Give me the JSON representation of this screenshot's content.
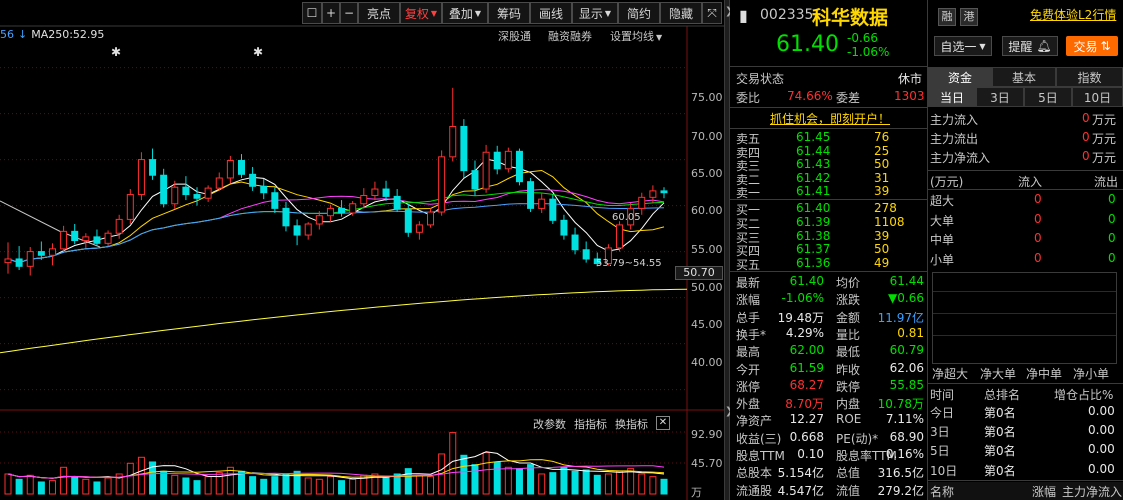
{
  "toolbar": {
    "buttons": [
      "亮点",
      "复权",
      "叠加",
      "筹码",
      "画线",
      "显示",
      "简约",
      "隐藏"
    ],
    "icons": [
      "lock-icon",
      "plus-icon",
      "minus-icon"
    ]
  },
  "chart": {
    "ma_legend": {
      "prefix": "56",
      "ma250_label": "MA250:52.95"
    },
    "sub_links": [
      "深股通",
      "融资融券",
      "设置均线"
    ],
    "right_ticks": [
      "75.00",
      "70.00",
      "65.00",
      "60.00",
      "55.00",
      "50.00",
      "45.00",
      "40.00"
    ],
    "current_price_box": "50.70",
    "annotations": [
      "60.05",
      "53.79",
      "54.55"
    ],
    "bottom_links": [
      "改参数",
      "指指标",
      "换指标"
    ],
    "vol_ticks": [
      "92.90",
      "45.70"
    ],
    "vol_unit": "万"
  },
  "chart_data": [
    {
      "type": "candlestick",
      "title": "",
      "ylim": [
        38,
        78
      ],
      "candles": [
        {
          "o": 53.8,
          "h": 56.0,
          "l": 52.6,
          "c": 54.2
        },
        {
          "o": 54.2,
          "h": 55.6,
          "l": 53.0,
          "c": 53.4
        },
        {
          "o": 53.4,
          "h": 55.5,
          "l": 52.4,
          "c": 55.0
        },
        {
          "o": 55.0,
          "h": 56.1,
          "l": 54.1,
          "c": 54.6
        },
        {
          "o": 54.6,
          "h": 55.9,
          "l": 53.5,
          "c": 55.3
        },
        {
          "o": 55.3,
          "h": 57.8,
          "l": 55.0,
          "c": 57.2
        },
        {
          "o": 57.2,
          "h": 58.0,
          "l": 55.8,
          "c": 56.2
        },
        {
          "o": 56.2,
          "h": 57.0,
          "l": 55.4,
          "c": 56.6
        },
        {
          "o": 56.6,
          "h": 57.4,
          "l": 55.6,
          "c": 55.9
        },
        {
          "o": 55.9,
          "h": 57.3,
          "l": 55.6,
          "c": 57.0
        },
        {
          "o": 57.0,
          "h": 59.0,
          "l": 56.4,
          "c": 58.5
        },
        {
          "o": 58.5,
          "h": 61.8,
          "l": 58.0,
          "c": 61.2
        },
        {
          "o": 61.2,
          "h": 65.8,
          "l": 60.6,
          "c": 65.0
        },
        {
          "o": 65.0,
          "h": 66.2,
          "l": 62.8,
          "c": 63.3
        },
        {
          "o": 63.3,
          "h": 64.0,
          "l": 59.8,
          "c": 60.2
        },
        {
          "o": 60.2,
          "h": 62.7,
          "l": 59.6,
          "c": 62.0
        },
        {
          "o": 62.0,
          "h": 63.2,
          "l": 60.6,
          "c": 61.2
        },
        {
          "o": 61.2,
          "h": 62.0,
          "l": 60.0,
          "c": 60.8
        },
        {
          "o": 60.8,
          "h": 62.2,
          "l": 60.4,
          "c": 61.9
        },
        {
          "o": 61.9,
          "h": 63.6,
          "l": 61.6,
          "c": 63.0
        },
        {
          "o": 63.0,
          "h": 65.4,
          "l": 62.4,
          "c": 64.9
        },
        {
          "o": 64.9,
          "h": 65.6,
          "l": 63.0,
          "c": 63.4
        },
        {
          "o": 63.4,
          "h": 64.2,
          "l": 61.6,
          "c": 62.1
        },
        {
          "o": 62.1,
          "h": 62.9,
          "l": 60.7,
          "c": 61.4
        },
        {
          "o": 61.4,
          "h": 62.0,
          "l": 59.2,
          "c": 59.7
        },
        {
          "o": 59.7,
          "h": 60.4,
          "l": 57.2,
          "c": 57.8
        },
        {
          "o": 57.8,
          "h": 58.5,
          "l": 55.7,
          "c": 56.8
        },
        {
          "o": 56.8,
          "h": 58.2,
          "l": 56.3,
          "c": 58.0
        },
        {
          "o": 58.0,
          "h": 59.4,
          "l": 57.4,
          "c": 58.9
        },
        {
          "o": 58.9,
          "h": 60.1,
          "l": 58.2,
          "c": 59.7
        },
        {
          "o": 59.7,
          "h": 60.6,
          "l": 58.8,
          "c": 59.2
        },
        {
          "o": 59.2,
          "h": 60.5,
          "l": 58.9,
          "c": 60.2
        },
        {
          "o": 60.2,
          "h": 61.9,
          "l": 59.7,
          "c": 61.1
        },
        {
          "o": 61.1,
          "h": 62.6,
          "l": 60.6,
          "c": 61.8
        },
        {
          "o": 61.8,
          "h": 62.7,
          "l": 60.5,
          "c": 61.0
        },
        {
          "o": 61.0,
          "h": 61.8,
          "l": 59.3,
          "c": 59.6
        },
        {
          "o": 59.6,
          "h": 60.2,
          "l": 56.6,
          "c": 57.1
        },
        {
          "o": 57.1,
          "h": 58.3,
          "l": 56.3,
          "c": 57.9
        },
        {
          "o": 57.9,
          "h": 59.7,
          "l": 57.6,
          "c": 59.3
        },
        {
          "o": 59.3,
          "h": 66.0,
          "l": 58.9,
          "c": 65.3
        },
        {
          "o": 65.3,
          "h": 72.8,
          "l": 64.8,
          "c": 68.6
        },
        {
          "o": 68.6,
          "h": 69.4,
          "l": 63.0,
          "c": 63.8
        },
        {
          "o": 63.8,
          "h": 64.9,
          "l": 61.1,
          "c": 61.8
        },
        {
          "o": 61.8,
          "h": 66.6,
          "l": 61.4,
          "c": 65.8
        },
        {
          "o": 65.8,
          "h": 66.5,
          "l": 63.4,
          "c": 64.0
        },
        {
          "o": 64.0,
          "h": 66.3,
          "l": 63.6,
          "c": 65.9
        },
        {
          "o": 65.9,
          "h": 66.2,
          "l": 62.2,
          "c": 62.6
        },
        {
          "o": 62.6,
          "h": 63.0,
          "l": 59.3,
          "c": 59.7
        },
        {
          "o": 59.7,
          "h": 61.4,
          "l": 59.2,
          "c": 60.7
        },
        {
          "o": 60.7,
          "h": 61.2,
          "l": 58.0,
          "c": 58.4
        },
        {
          "o": 58.4,
          "h": 59.0,
          "l": 56.3,
          "c": 56.8
        },
        {
          "o": 56.8,
          "h": 57.6,
          "l": 54.7,
          "c": 55.2
        },
        {
          "o": 55.2,
          "h": 56.1,
          "l": 53.8,
          "c": 54.2
        },
        {
          "o": 54.2,
          "h": 54.9,
          "l": 53.4,
          "c": 53.7
        },
        {
          "o": 53.7,
          "h": 55.8,
          "l": 53.5,
          "c": 55.4
        },
        {
          "o": 55.4,
          "h": 58.3,
          "l": 55.0,
          "c": 57.9
        },
        {
          "o": 57.9,
          "h": 60.3,
          "l": 57.4,
          "c": 59.7
        },
        {
          "o": 59.7,
          "h": 61.4,
          "l": 59.0,
          "c": 60.9
        },
        {
          "o": 60.9,
          "h": 62.2,
          "l": 60.3,
          "c": 61.6
        },
        {
          "o": 61.6,
          "h": 62.0,
          "l": 60.8,
          "c": 61.4
        }
      ]
    },
    {
      "type": "bar",
      "title": "",
      "ylim": [
        0,
        92.9
      ],
      "values": [
        30,
        22,
        28,
        18,
        20,
        40,
        26,
        22,
        18,
        24,
        30,
        46,
        55,
        48,
        34,
        28,
        24,
        20,
        26,
        32,
        40,
        34,
        26,
        22,
        26,
        30,
        34,
        24,
        22,
        26,
        20,
        22,
        28,
        30,
        26,
        30,
        38,
        28,
        26,
        60,
        92,
        58,
        44,
        62,
        48,
        40,
        38,
        44,
        30,
        32,
        40,
        34,
        36,
        28,
        30,
        34,
        38,
        30,
        26,
        22
      ],
      "up": [
        true,
        false,
        true,
        false,
        true,
        true,
        false,
        true,
        false,
        true,
        true,
        true,
        true,
        false,
        false,
        true,
        false,
        false,
        true,
        true,
        true,
        false,
        false,
        false,
        false,
        false,
        false,
        true,
        true,
        true,
        false,
        true,
        true,
        true,
        false,
        false,
        false,
        true,
        true,
        true,
        true,
        false,
        false,
        true,
        false,
        true,
        false,
        false,
        true,
        false,
        false,
        false,
        false,
        false,
        true,
        true,
        true,
        true,
        true,
        false
      ]
    }
  ],
  "quote": {
    "code": "002335",
    "name": "科华数据",
    "price": "61.40",
    "change": "-0.66",
    "change_pct": "-1.06%",
    "trade_status_label": "交易状态",
    "trade_status_value": "休市",
    "weibi_label": "委比",
    "weibi_value": "74.66%",
    "weicha_label": "委差",
    "weicha_value": "1303",
    "promo": "抓住机会，即刻开户！",
    "asks": [
      {
        "label": "卖五",
        "price": "61.45",
        "vol": "76"
      },
      {
        "label": "卖四",
        "price": "61.44",
        "vol": "25"
      },
      {
        "label": "卖三",
        "price": "61.43",
        "vol": "50"
      },
      {
        "label": "卖二",
        "price": "61.42",
        "vol": "31"
      },
      {
        "label": "卖一",
        "price": "61.41",
        "vol": "39"
      }
    ],
    "bids": [
      {
        "label": "买一",
        "price": "61.40",
        "vol": "278"
      },
      {
        "label": "买二",
        "price": "61.39",
        "vol": "1108"
      },
      {
        "label": "买三",
        "price": "61.38",
        "vol": "39"
      },
      {
        "label": "买四",
        "price": "61.37",
        "vol": "50"
      },
      {
        "label": "买五",
        "price": "61.36",
        "vol": "49"
      }
    ],
    "stats": [
      {
        "l1": "最新",
        "v1": "61.40",
        "c1": "green",
        "l2": "均价",
        "v2": "61.44",
        "c2": "green"
      },
      {
        "l1": "涨幅",
        "v1": "-1.06%",
        "c1": "green",
        "l2": "涨跌",
        "v2": "▼0.66",
        "c2": "green"
      },
      {
        "l1": "总手",
        "v1": "19.48万",
        "c1": "white",
        "l2": "金额",
        "v2": "11.97亿",
        "c2": "blue"
      },
      {
        "l1": "换手*",
        "v1": "4.29%",
        "c1": "white",
        "l2": "量比",
        "v2": "0.81",
        "c2": "yellow"
      },
      {
        "l1": "最高",
        "v1": "62.00",
        "c1": "green",
        "l2": "最低",
        "v2": "60.79",
        "c2": "green"
      },
      {
        "l1": "今开",
        "v1": "61.59",
        "c1": "green",
        "l2": "昨收",
        "v2": "62.06",
        "c2": "white"
      },
      {
        "l1": "涨停",
        "v1": "68.27",
        "c1": "red",
        "l2": "跌停",
        "v2": "55.85",
        "c2": "green"
      },
      {
        "l1": "外盘",
        "v1": "8.70万",
        "c1": "red",
        "l2": "内盘",
        "v2": "10.78万",
        "c2": "green"
      },
      {
        "l1": "净资产",
        "v1": "12.27",
        "c1": "white",
        "l2": "ROE",
        "v2": "7.11%",
        "c2": "white"
      },
      {
        "l1": "收益(三)",
        "v1": "0.668",
        "c1": "white",
        "l2": "PE(动)*",
        "v2": "68.90",
        "c2": "white"
      },
      {
        "l1": "股息TTM",
        "v1": "0.10",
        "c1": "white",
        "l2": "股息率TTM",
        "v2": "0.16%",
        "c2": "white"
      },
      {
        "l1": "总股本",
        "v1": "5.154亿",
        "c1": "white",
        "l2": "总值",
        "v2": "316.5亿",
        "c2": "white"
      },
      {
        "l1": "流通股",
        "v1": "4.547亿",
        "c1": "white",
        "l2": "流值",
        "v2": "279.2亿",
        "c2": "white"
      }
    ]
  },
  "flow": {
    "badge1": "融",
    "badge2": "港",
    "trial_link": "免费体验L2行情",
    "select_btn": "自选一",
    "remind_btn": "提醒",
    "trade_btn": "交易",
    "main_tabs": [
      "资金",
      "基本",
      "指数"
    ],
    "period_tabs": [
      "当日",
      "3日",
      "5日",
      "10日"
    ],
    "flows": [
      {
        "label": "主力流入",
        "value": "0",
        "unit": "万元"
      },
      {
        "label": "主力流出",
        "value": "0",
        "unit": "万元"
      },
      {
        "label": "主力净流入",
        "value": "0",
        "unit": "万元"
      }
    ],
    "table_head": [
      "(万元)",
      "流入",
      "流出"
    ],
    "table_rows": [
      {
        "label": "超大",
        "in": "0",
        "out": "0"
      },
      {
        "label": "大单",
        "in": "0",
        "out": "0"
      },
      {
        "label": "中单",
        "in": "0",
        "out": "0"
      },
      {
        "label": "小单",
        "in": "0",
        "out": "0"
      }
    ],
    "net_labels": [
      "净超大",
      "净大单",
      "净中单",
      "净小单"
    ],
    "rank_head": [
      "时间",
      "总排名",
      "增仓占比%"
    ],
    "rank_rows": [
      {
        "t": "今日",
        "r": "第0名",
        "p": "0.00"
      },
      {
        "t": "3日",
        "r": "第0名",
        "p": "0.00"
      },
      {
        "t": "5日",
        "r": "第0名",
        "p": "0.00"
      },
      {
        "t": "10日",
        "r": "第0名",
        "p": "0.00"
      }
    ],
    "bottom_head": [
      "名称",
      "涨幅",
      "主力净流入"
    ]
  },
  "colors": {
    "up": "#ff3030",
    "down": "#00e0e0",
    "ma5": "#ffffff",
    "ma10": "#ffd700",
    "ma20": "#ff40ff",
    "ma30": "#00e000",
    "ma60": "#4aa0ff",
    "ma250": "#ffff40"
  }
}
